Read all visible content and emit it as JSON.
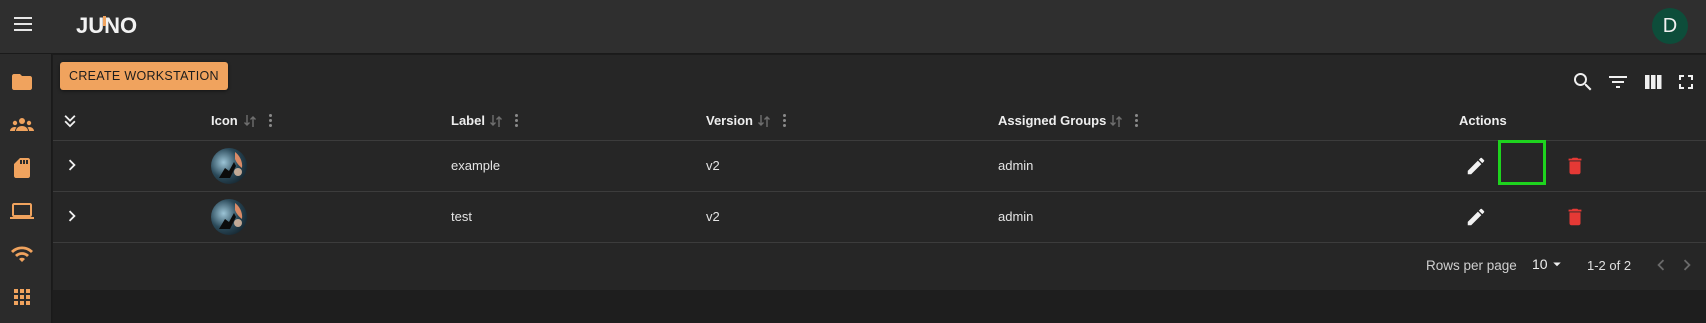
{
  "app": {
    "logo_text": "JUNO",
    "user_initial": "D"
  },
  "colors": {
    "accent": "#f0a35e",
    "avatar": "#0d4d3a",
    "delete": "#e53935",
    "highlight": "#1ed31e"
  },
  "sidebar": {
    "items": [
      {
        "icon": "folder-icon"
      },
      {
        "icon": "groups-icon"
      },
      {
        "icon": "sd-card-icon"
      },
      {
        "icon": "laptop-icon"
      },
      {
        "icon": "wifi-icon"
      },
      {
        "icon": "apps-grid-icon"
      }
    ]
  },
  "toolbar": {
    "create_label": "CREATE WORKSTATION",
    "icons": [
      "search-icon",
      "filter-icon",
      "columns-icon",
      "fullscreen-icon"
    ]
  },
  "table": {
    "columns": {
      "icon": "Icon",
      "label": "Label",
      "version": "Version",
      "groups": "Assigned Groups",
      "actions": "Actions"
    },
    "rows": [
      {
        "label": "example",
        "version": "v2",
        "groups": "admin"
      },
      {
        "label": "test",
        "version": "v2",
        "groups": "admin"
      }
    ]
  },
  "pagination": {
    "rows_per_page_label": "Rows per page",
    "rows_per_page": "10",
    "range": "1-2 of 2"
  }
}
